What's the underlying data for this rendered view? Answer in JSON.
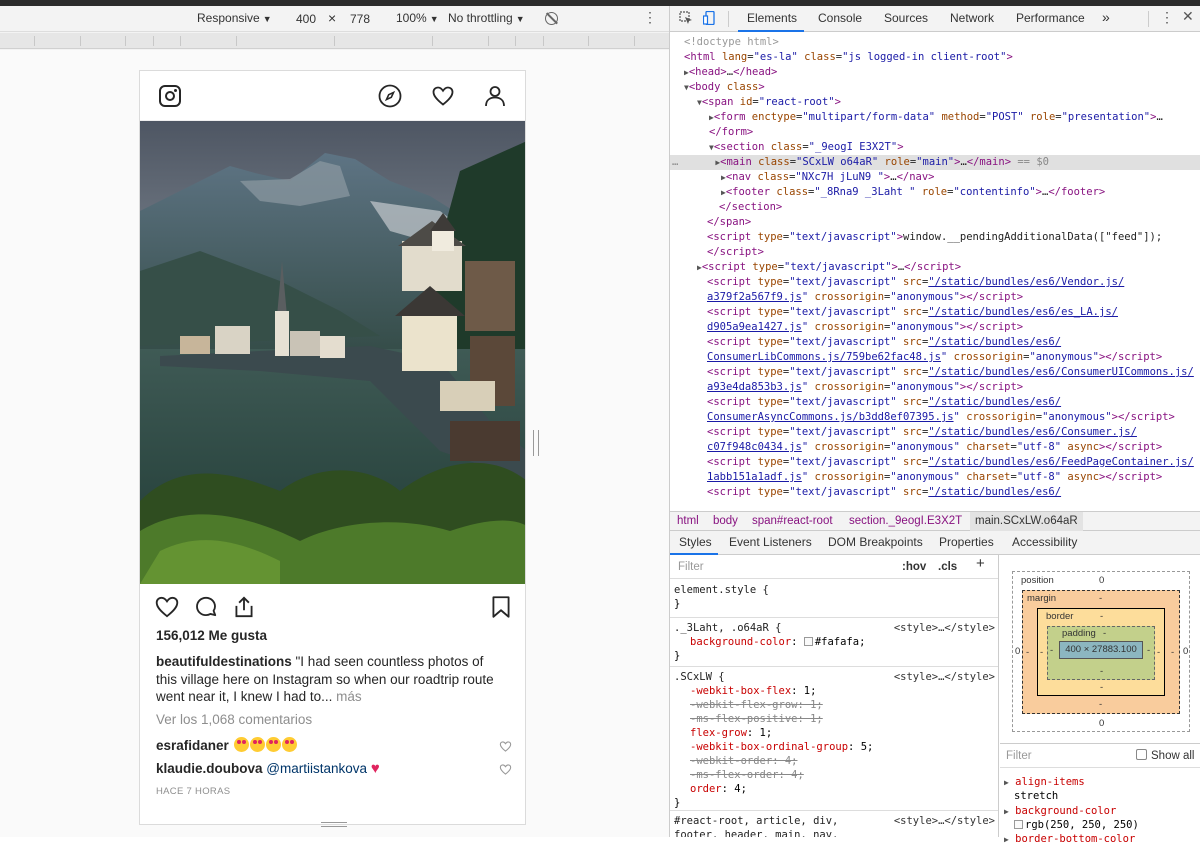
{
  "device_toolbar": {
    "device": "Responsive",
    "width": "400",
    "times": "×",
    "height": "778",
    "zoom": "100%",
    "throttle": "No throttling"
  },
  "instagram": {
    "likes": "156,012 Me gusta",
    "caption_user": "beautifuldestinations",
    "caption_text": " \"I had seen countless photos of this village here on Instagram so when our roadtrip route went near it, I knew I had to...",
    "caption_more": " más",
    "view_comments": "Ver los 1,068 comentarios",
    "comments": [
      {
        "user": "esrafidaner",
        "text": ""
      },
      {
        "user": "klaudie.doubova",
        "mention": "@martiistankova"
      }
    ],
    "timestamp": "HACE 7 HORAS"
  },
  "devtools": {
    "tabs": [
      "Elements",
      "Console",
      "Sources",
      "Network",
      "Performance",
      "»"
    ],
    "breadcrumbs": [
      "html",
      "body",
      "span#react-root",
      "section._9eogI.E3X2T",
      "main.SCxLW.o64aR"
    ],
    "subtabs": [
      "Styles",
      "Event Listeners",
      "DOM Breakpoints",
      "Properties",
      "Accessibility"
    ],
    "filter_placeholder": "Filter",
    "hov": ":hov",
    "cls": ".cls",
    "plus": "+",
    "box_model": {
      "position_label": "position",
      "position_val": "0",
      "margin_label": "margin",
      "border_label": "border",
      "padding_label": "padding",
      "content": "400 × 27883.100",
      "dash": "-",
      "zero": "0"
    },
    "computed": {
      "filter": "Filter",
      "show_all": "Show all",
      "props": [
        {
          "name": "align-items",
          "value": "stretch"
        },
        {
          "name": "background-color",
          "value": "rgb(250, 250, 250)"
        },
        {
          "name": "border-bottom-color",
          "value": ""
        }
      ]
    }
  },
  "colors": {
    "accent": "#1a73e8",
    "tag": "#881280",
    "attr": "#994500",
    "value": "#1a1aa6"
  }
}
